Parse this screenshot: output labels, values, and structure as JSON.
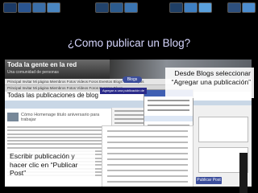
{
  "slide": {
    "title": "¿Como publicar un Blog?",
    "callouts": {
      "select_blogs": "Desde Blogs seleccionar “Agregar una publicación”",
      "write_post": "Escribir publicación y hacer clic en “Publicar Post”"
    }
  },
  "screenshot": {
    "blog_title": "Toda la gente en la red",
    "blog_subtitle": "Una comunidad de personas",
    "nav_links": "Principal   Invitar   Mi página   Miembros   Fotos   Videos   Foros   Eventos   Blogs   Chat   Grupos",
    "menu_links": "Principal   Invitar   Mi página   Miembros   Fotos   Vídeos   Foros   Eventos   Blogs",
    "page_header": "Todas las publicaciones de blog",
    "post_title": "Cómo Homenage titulo aniversario para trabajar",
    "blogs_button": "Blogs",
    "add_post_button": "Agregar a una publicación de blog",
    "publish_button": "Publicar Post"
  },
  "colors": {
    "background": "#000000",
    "title": "#d7d7ff",
    "accent": "#3c4e9c"
  }
}
